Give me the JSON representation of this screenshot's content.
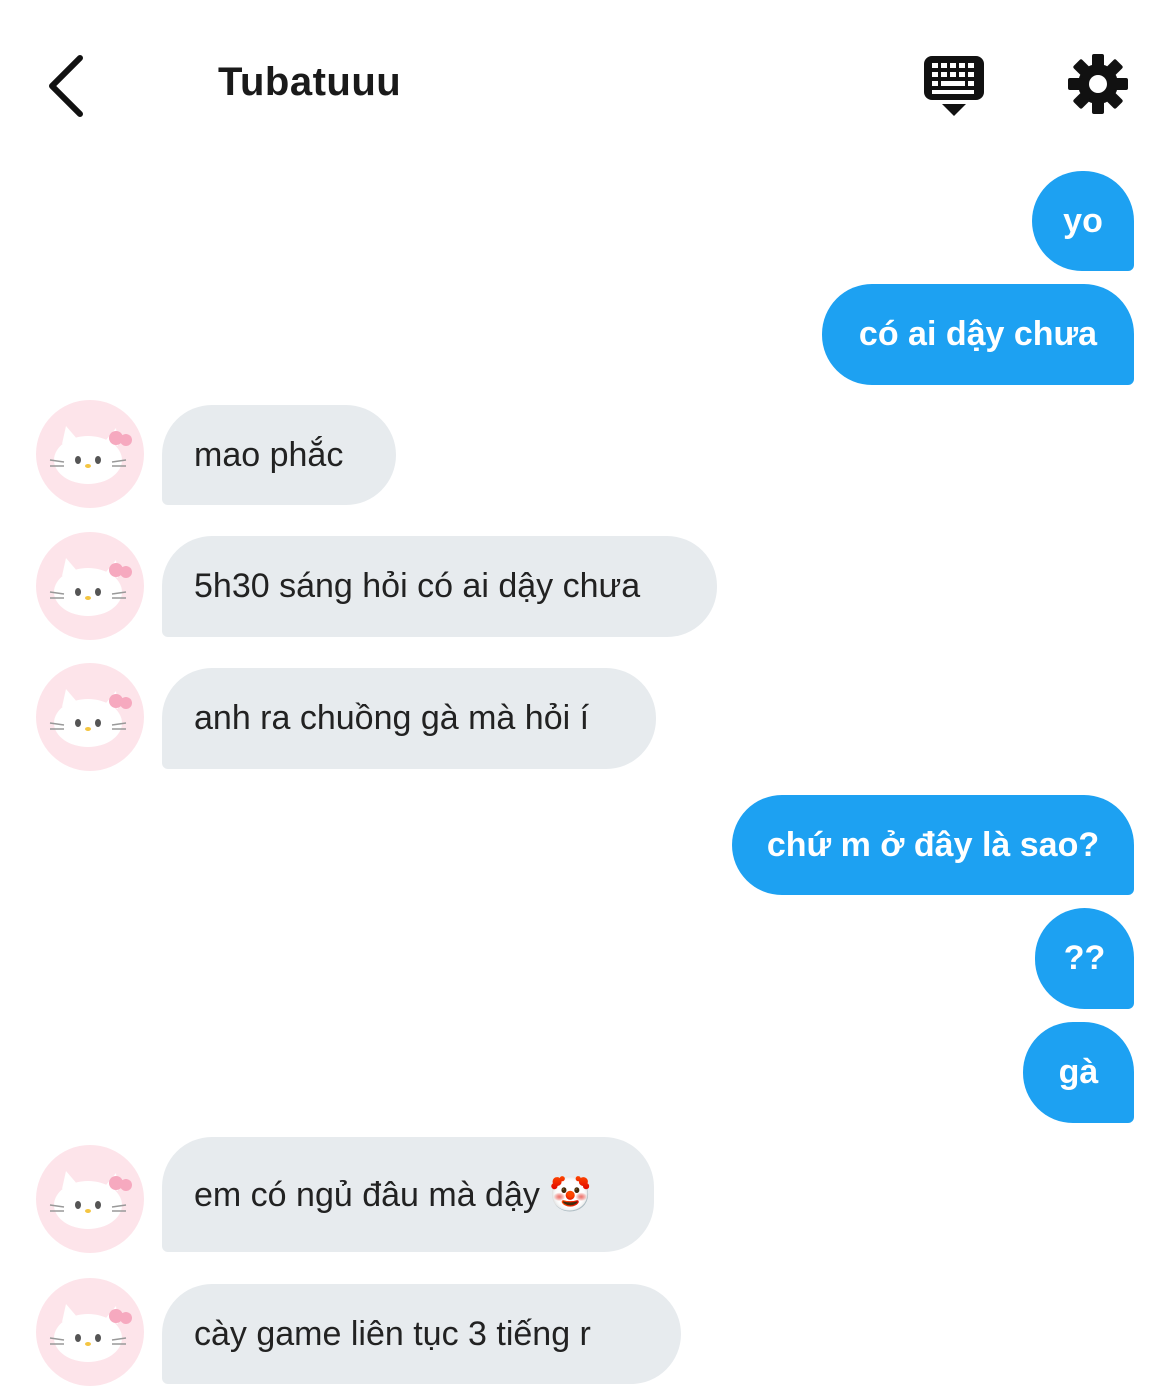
{
  "header": {
    "title": "Tubatuuu",
    "back_icon": "chevron-left-icon",
    "keyboard_icon": "keyboard-icon",
    "settings_icon": "gear-icon"
  },
  "colors": {
    "outgoing_bubble": "#1DA1F2",
    "incoming_bubble": "#e7ebee",
    "avatar_bg": "#fde4ea"
  },
  "messages": [
    {
      "direction": "out",
      "text": "yo"
    },
    {
      "direction": "out",
      "text": "có ai dậy chưa"
    },
    {
      "direction": "in",
      "text": "mao phắc"
    },
    {
      "direction": "in",
      "text": "5h30 sáng hỏi có ai dậy chưa"
    },
    {
      "direction": "in",
      "text": "anh ra chuồng gà mà hỏi í"
    },
    {
      "direction": "out",
      "text": "chứ m ở đây là sao?"
    },
    {
      "direction": "out",
      "text": "??"
    },
    {
      "direction": "out",
      "text": "gà"
    },
    {
      "direction": "in",
      "text": "em có ngủ đâu mà dậy 🤡"
    },
    {
      "direction": "in",
      "text": "cày game liên tục 3 tiếng r"
    }
  ],
  "avatar_icon": "hello-kitty-avatar-icon"
}
